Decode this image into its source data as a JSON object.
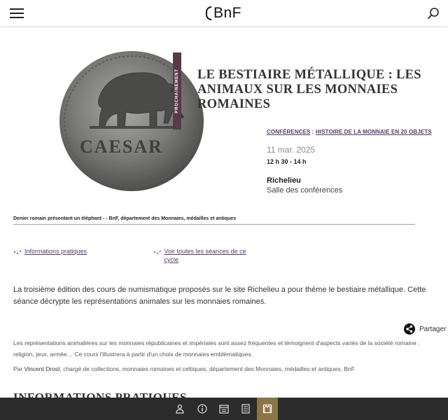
{
  "header": {
    "logo_text": "BnF",
    "menu_label": "Menu",
    "search_label": "Rechercher"
  },
  "event": {
    "badge": "PROCHAINEMENT",
    "title": "LE BESTIAIRE MÉTALLIQUE : LES ANIMAUX SUR LES MONNAIES ROMAINES",
    "category": "CONFÉRENCES",
    "separator": " : ",
    "series": "HISTOIRE DE LA MONNAIE EN 20 OBJETS",
    "date": "11 mar. 2025",
    "time": "12 h 30 - 14 h",
    "site": "Richelieu",
    "room": "Salle des conférences",
    "image_caption": "Denier romain présentant un éléphant - - BnF, département des Monnaies, médailles et antiques",
    "coin_legend": "CAESAR"
  },
  "links": {
    "info": "Informations pratiques",
    "sessions": "Voir toutes les séances de ce cycle"
  },
  "body": {
    "intro": "La troisième édition des cours de numismatique proposés sur le site Richelieu a pour thème le bestiaire métallique. Cette séance décrypte les représentations animales sur les monnaies romaines.",
    "share_label": "Partager",
    "paragraph1": "Les représentations animalières sur les monnaies républicaines et impériales sont assez fréquentes et témoignent d'aspects variés de la société romaine : religion, jeux, armée… Ce cours l'illustrera à partir d'un choix de monnaies emblématiques.",
    "by": "Par ",
    "author": "Vincent Drost",
    "author_role": ", chargé de collections, monnaies romaines et celtiques, département des Monnaies, médailles et antiques, BnF",
    "section_heading": "INFORMATIONS PRATIQUES"
  },
  "toolbar": {
    "items": [
      "visitor-icon",
      "info-icon",
      "calendar-icon",
      "catalog-icon",
      "museum-icon"
    ],
    "active_index": 4,
    "active_color": "#8b7447"
  },
  "colors": {
    "accent": "#5a3a6a",
    "badge_bg": "#5a3a4a",
    "toolbar_bg": "#2b2b2b"
  }
}
